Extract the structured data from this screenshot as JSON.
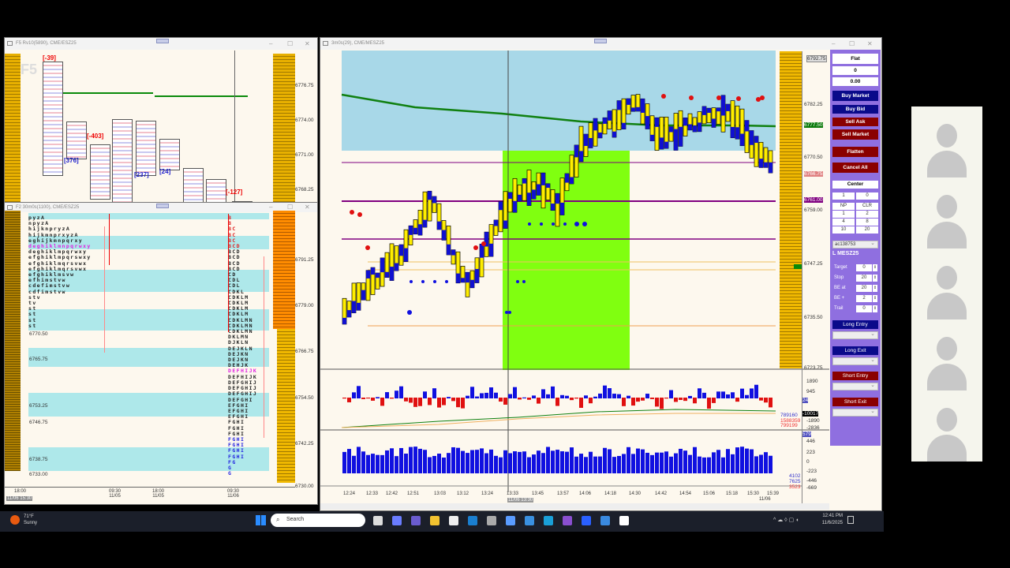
{
  "windows": {
    "top_left": {
      "title": "F5 Rv10(5890), CME/ESZ25",
      "watermark": "F5",
      "deltas": [
        "[-39]",
        "[376]",
        "[-403]",
        "[237]",
        "[24]",
        "[-127]"
      ],
      "prices": [
        "6776.75",
        "6774.00",
        "6771.00",
        "6768.25"
      ]
    },
    "bottom_left": {
      "title": "F2 30m0s(1100), CME/ESZ25",
      "prices": [
        "6791.25",
        "6779.00",
        "6766.75",
        "6754.50",
        "6742.25",
        "6730.00"
      ],
      "inner_prices": [
        "6770.50",
        "6765.75",
        "6753.25",
        "6746.75",
        "6738.75",
        "6733.00"
      ],
      "left_letters": [
        "pyzA",
        "npyzA",
        "hijknpryzA",
        "hijkmnprxyzA",
        "eghijkmnpqrxy",
        "deghiklmnpqrwxy",
        "deghiklmpqrwxy",
        "efghiklmpqrswxy",
        "efghiklmqrsvwx",
        "efghiklmqrsvwx",
        "efghiklmsvw",
        "efhimstvw",
        "cdefimstvw",
        "cdfimstvw",
        "stv",
        "tv",
        "st",
        "st",
        "st",
        "st"
      ],
      "right_letters": [
        "B",
        "B",
        "BC",
        "BC",
        "BC",
        "BCD",
        "BCD",
        "BCD",
        "BCD",
        "BCD",
        "CD",
        "CDL",
        "CDL",
        "CDKL",
        "CDKLM",
        "CDKLM",
        "CDKLM",
        "CDKLM",
        "CDKLMN",
        "CDKLMN",
        "CDKLMN",
        "DKLMN",
        "DJKLN",
        "DEJKLN",
        "DEJKN",
        "DEJKN",
        "DEHJK",
        "DEFHIJK",
        "DEFHIJK",
        "DEFGHIJ",
        "DEFGHIJ",
        "DEFGHIJ",
        "DEFGHI",
        "EFGHI",
        "EFGHI",
        "EFGHI",
        "FGHI",
        "FGHI",
        "FGHI",
        "FGHI",
        "FGHI",
        "FGHI",
        "FGHI",
        "FG",
        "G",
        "G"
      ],
      "time_ticks": [
        {
          "t": "18:00",
          "d": ""
        },
        {
          "t": "09:30",
          "d": "11/05"
        },
        {
          "t": "18:00",
          "d": "11/05"
        },
        {
          "t": "09:30",
          "d": "11/06"
        }
      ],
      "cursor_time": "11/06 15:30"
    },
    "main": {
      "title": "3m0s(29), CME/MESZ25",
      "prices": [
        "6782.25",
        "6770.50",
        "6759.00",
        "6747.25",
        "6735.50",
        "6723.75"
      ],
      "top_price": "6792.75",
      "poc_label": "6777.50",
      "last_label": "6766.75",
      "level_label": "6761.00",
      "delta_axis": [
        "1890",
        "945",
        "-1890",
        "-2836"
      ],
      "delta_marker": "-10017",
      "delta_small": "24",
      "delta_stats": [
        "789160",
        "1588359",
        "799199"
      ],
      "vol_axis": [
        "446",
        "223",
        "0",
        "-223",
        "-446",
        "-669"
      ],
      "vol_marker": "579",
      "vol_stats": [
        "4102",
        "7625",
        "3523"
      ],
      "time_ticks": [
        "12:24",
        "12:33",
        "12:42",
        "12:51",
        "13:03",
        "13:12",
        "13:24",
        "13:33",
        "13:45",
        "13:57",
        "14:06",
        "14:18",
        "14:30",
        "14:42",
        "14:54",
        "15:06",
        "15:18",
        "15:30",
        "15:39"
      ],
      "last_date": "11/06",
      "cursor_time": "11/06 13:30"
    }
  },
  "panel": {
    "position": "Flat",
    "qty": "0",
    "pnl": "0.00",
    "buy_market": "Buy Market",
    "buy_bid": "Buy Bid",
    "sell_ask": "Sell Ask",
    "sell_market": "Sell Market",
    "flatten": "Flatten",
    "cancel_all": "Cancel All",
    "center": "Center",
    "qty_input": "1",
    "qty_right": "0",
    "grid": [
      [
        "NP",
        "CLR"
      ],
      [
        "1",
        "2"
      ],
      [
        "4",
        "8"
      ],
      [
        "10",
        "20"
      ]
    ],
    "account": "ac138753",
    "instrument": "L MESZ25",
    "params": [
      {
        "label": "Target",
        "value": "0"
      },
      {
        "label": "Stop",
        "value": "20"
      },
      {
        "label": "BE at",
        "value": "20"
      },
      {
        "label": "BE +",
        "value": "2"
      },
      {
        "label": "Trail",
        "value": "0"
      }
    ],
    "long_entry": "Long Entry",
    "long_exit": "Long Exit",
    "short_entry": "Short Entry",
    "short_exit": "Short Exit"
  },
  "taskbar": {
    "temp": "71°F",
    "weather": "Sunny",
    "search": "Search",
    "time": "12:41 PM",
    "date": "11/6/2025"
  }
}
